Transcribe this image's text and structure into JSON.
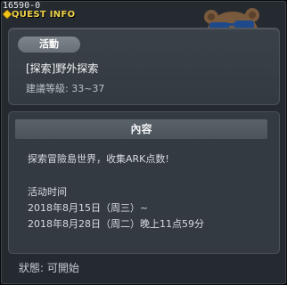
{
  "window": {
    "quest_id": "16590-0",
    "title": "QUEST INFO"
  },
  "summary": {
    "tag": "活動",
    "quest_name": "[探索]野外探索",
    "level_requirement": "建議等級: 33~37"
  },
  "content": {
    "header": "內容",
    "description": "探索冒險島世界，收集ARK点数!",
    "period_label": "活动时间",
    "start": "2018年8月15日（周三）~",
    "end": "2018年8月28日（周二）晚上11点59分"
  },
  "status": {
    "text": "狀態: 可開始"
  },
  "colors": {
    "title": "#f0d24a",
    "panel": "#3a4148",
    "background": "#252a30"
  }
}
